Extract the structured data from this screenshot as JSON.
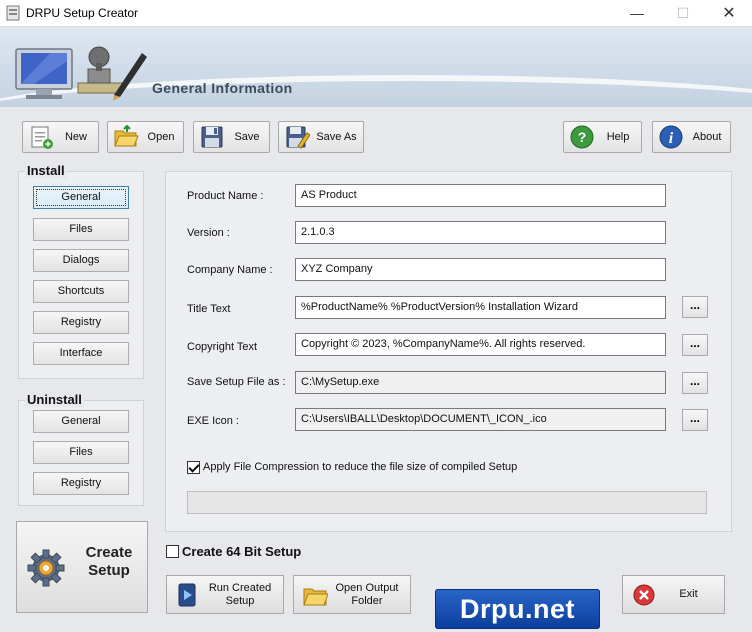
{
  "window": {
    "title": "DRPU Setup Creator",
    "minimize_glyph": "—",
    "maximize_glyph": "☐",
    "close_glyph": "✕"
  },
  "banner": {
    "heading": "General Information"
  },
  "toolbar": {
    "new_label": "New",
    "open_label": "Open",
    "save_label": "Save",
    "save_as_label": "Save As",
    "help_label": "Help",
    "about_label": "About"
  },
  "install": {
    "title": "Install",
    "items": [
      "General",
      "Files",
      "Dialogs",
      "Shortcuts",
      "Registry",
      "Interface"
    ],
    "active": "General"
  },
  "uninstall": {
    "title": "Uninstall",
    "items": [
      "General",
      "Files",
      "Registry"
    ]
  },
  "create_setup": {
    "line1": "Create",
    "line2": "Setup"
  },
  "form": {
    "product_name_label": "Product Name :",
    "product_name_value": "AS Product",
    "version_label": "Version :",
    "version_value": "2.1.0.3",
    "company_name_label": "Company Name :",
    "company_name_value": "XYZ Company",
    "title_text_label": "Title Text",
    "title_text_value": "%ProductName% %ProductVersion% Installation Wizard",
    "copyright_label": "Copyright Text",
    "copyright_value": "Copyright © 2023, %CompanyName%. All rights reserved.",
    "save_as_label": "Save Setup File as :",
    "save_as_value": "C:\\MySetup.exe",
    "exe_icon_label": "EXE Icon :",
    "exe_icon_value": "C:\\Users\\IBALL\\Desktop\\DOCUMENT\\_ICON_.ico",
    "browse_label": "...",
    "compression_label": "Apply File Compression to reduce the file size of compiled Setup",
    "compression_checked": true
  },
  "create64": {
    "label": "Create 64 Bit Setup",
    "checked": false
  },
  "bottom": {
    "run_line1": "Run Created",
    "run_line2": "Setup",
    "open_line1": "Open Output",
    "open_line2": "Folder",
    "exit_label": "Exit"
  },
  "logo": {
    "text": "Drpu.net"
  },
  "icons": {
    "app": "app-icon",
    "new": "new-document-icon",
    "open": "open-folder-icon",
    "save": "save-disk-icon",
    "save_as": "save-as-icon",
    "help": "help-question-icon",
    "about": "info-icon",
    "create": "gear-icon",
    "run": "run-setup-icon",
    "open_output": "folder-icon",
    "exit": "exit-icon"
  }
}
